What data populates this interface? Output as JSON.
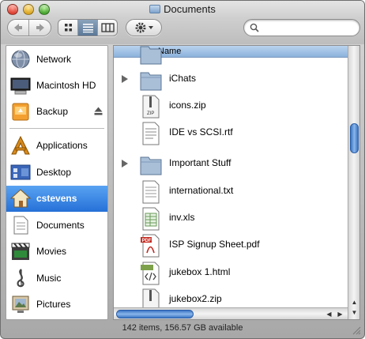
{
  "window": {
    "title": "Documents",
    "status": "142 items, 156.57 GB available"
  },
  "toolbar": {
    "back_icon": "back-arrow-icon",
    "forward_icon": "forward-arrow-icon",
    "view_modes": [
      "icon-view-icon",
      "list-view-icon",
      "column-view-icon"
    ],
    "selected_view": "list",
    "action_icon": "gear-icon",
    "search_placeholder": ""
  },
  "sidebar": {
    "devices": [
      {
        "label": "Network",
        "icon": "network-globe-icon"
      },
      {
        "label": "Macintosh HD",
        "icon": "hard-drive-icon"
      },
      {
        "label": "Backup",
        "icon": "external-drive-icon",
        "ejectable": true
      }
    ],
    "places": [
      {
        "label": "Applications",
        "icon": "applications-icon"
      },
      {
        "label": "Desktop",
        "icon": "desktop-icon"
      },
      {
        "label": "cstevens",
        "icon": "home-icon",
        "selected": true
      },
      {
        "label": "Documents",
        "icon": "documents-icon"
      },
      {
        "label": "Movies",
        "icon": "movies-icon"
      },
      {
        "label": "Music",
        "icon": "music-icon"
      },
      {
        "label": "Pictures",
        "icon": "pictures-icon"
      }
    ]
  },
  "list": {
    "column_header": "Name",
    "rows": [
      {
        "name": "iChats",
        "kind": "folder",
        "expandable": true
      },
      {
        "name": "icons.zip",
        "kind": "zip"
      },
      {
        "name": "IDE vs SCSI.rtf",
        "kind": "rtf"
      },
      {
        "name": "Important Stuff",
        "kind": "folder",
        "expandable": true
      },
      {
        "name": "international.txt",
        "kind": "txt"
      },
      {
        "name": "inv.xls",
        "kind": "xls"
      },
      {
        "name": "ISP Signup Sheet.pdf",
        "kind": "pdf"
      },
      {
        "name": "jukebox 1.html",
        "kind": "html"
      },
      {
        "name": "jukebox2.zip",
        "kind": "zip"
      }
    ]
  },
  "colors": {
    "selection": "#2570d7",
    "header": "#8cb2dc",
    "scroll_thumb": "#3b75c4"
  }
}
